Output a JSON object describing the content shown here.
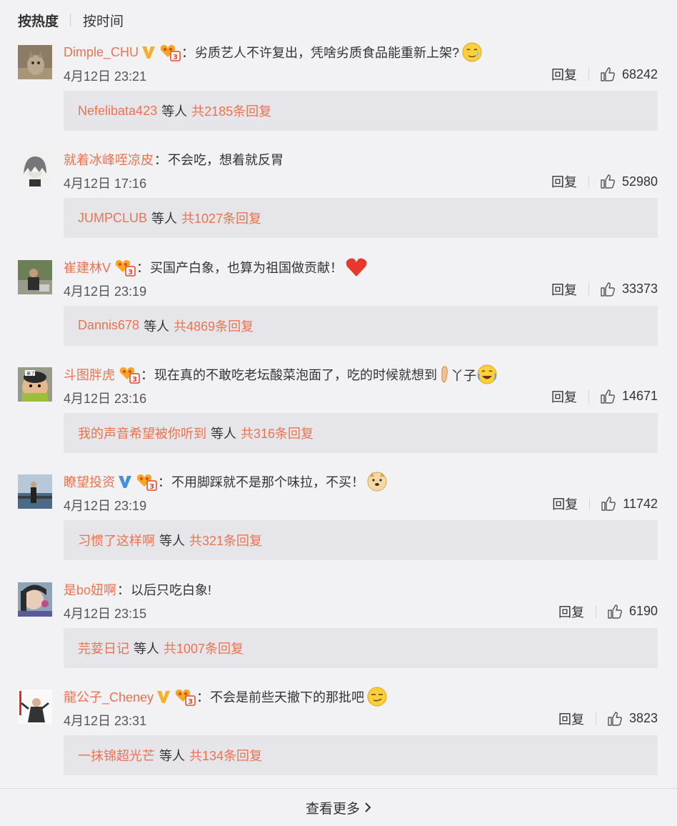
{
  "sort": {
    "hot_label": "按热度",
    "time_label": "按时间"
  },
  "comments": [
    {
      "username": "Dimple_CHU",
      "verified": true,
      "vip": true,
      "content": "劣质艺人不许复出，凭啥劣质食品能重新上架?",
      "emoji": "sweat-smile-emoji",
      "time": "4月12日 23:21",
      "reply_label": "回复",
      "likes": "68242",
      "reply_user": "Nefelibata423",
      "reply_mid": "等人",
      "reply_count": "共2185条回复"
    },
    {
      "username": "就着冰峰咥凉皮",
      "verified": false,
      "vip": false,
      "content": "不会吃，想着就反胃",
      "emoji": "",
      "time": "4月12日 17:16",
      "reply_label": "回复",
      "likes": "52980",
      "reply_user": "JUMPCLUB",
      "reply_mid": "等人",
      "reply_count": "共1027条回复"
    },
    {
      "username": "崔建林V",
      "verified": false,
      "vip": true,
      "content": "买国产白象，也算为祖国做贡献！",
      "emoji": "heart-emoji",
      "time": "4月12日 23:19",
      "reply_label": "回复",
      "likes": "33373",
      "reply_user": "Dannis678",
      "reply_mid": "等人",
      "reply_count": "共4869条回复"
    },
    {
      "username": "斗图胖虎",
      "verified": false,
      "vip": true,
      "content": "现在真的不敢吃老坛酸菜泡面了，吃的时候就想到",
      "emoji": "foot-yazi-laugh-emoji",
      "time": "4月12日 23:16",
      "reply_label": "回复",
      "likes": "14671",
      "reply_user": "我的声音希望被你听到",
      "reply_mid": "等人",
      "reply_count": "共316条回复"
    },
    {
      "username": "瞭望投资",
      "verified": true,
      "vip": true,
      "content": "不用脚踩就不是那个味拉，不买！",
      "emoji": "doge-emoji",
      "time": "4月12日 23:19",
      "reply_label": "回复",
      "likes": "11742",
      "reply_user": "习惯了这样啊",
      "reply_mid": "等人",
      "reply_count": "共321条回复"
    },
    {
      "username": "是bo妞啊",
      "verified": false,
      "vip": false,
      "content": "以后只吃白象!",
      "emoji": "",
      "time": "4月12日 23:15",
      "reply_label": "回复",
      "likes": "6190",
      "reply_user": "芫荽日记",
      "reply_mid": "等人",
      "reply_count": "共1007条回复"
    },
    {
      "username": "龍公子_Cheney",
      "verified": true,
      "vip": true,
      "content": "不会是前些天撤下的那批吧",
      "emoji": "smirk-emoji",
      "time": "4月12日 23:31",
      "reply_label": "回复",
      "likes": "3823",
      "reply_user": "一抹锦超光芒",
      "reply_mid": "等人",
      "reply_count": "共134条回复"
    }
  ],
  "more": {
    "label": "查看更多"
  },
  "colors": {
    "link": "#eb7350",
    "background": "#f2f2f5",
    "reply_box": "#e6e6ea",
    "verified_gold": "#f3b12b",
    "verified_blue": "#4a8ee0"
  }
}
